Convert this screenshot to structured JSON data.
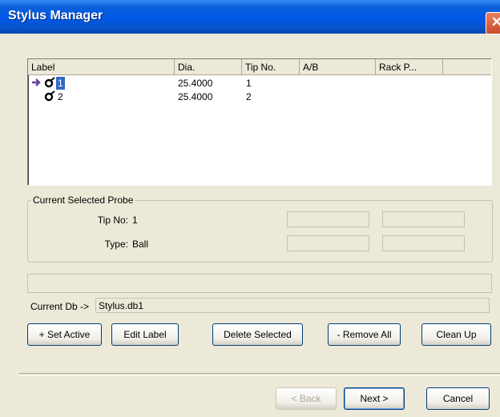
{
  "window": {
    "title": "Stylus Manager",
    "close_glyph": "✕"
  },
  "list": {
    "columns": [
      "Label",
      "Dia.",
      "Tip No.",
      "A/B",
      "Rack P..."
    ],
    "rows": [
      {
        "label": "1",
        "dia": "25.4000",
        "tip": "1",
        "active": true,
        "selected": true
      },
      {
        "label": "2",
        "dia": "25.4000",
        "tip": "2",
        "active": false,
        "selected": false
      }
    ],
    "icons": {
      "active": "active-arrow-icon",
      "probe": "probe-icon"
    }
  },
  "probe": {
    "group_label": "Current Selected Probe",
    "tip_label": "Tip No:",
    "tip_value": "1",
    "type_label": "Type:",
    "type_value": "Ball"
  },
  "db": {
    "label": "Current Db ->",
    "value": "Stylus.db1"
  },
  "buttons": {
    "set_active": "+ Set Active",
    "edit_label": "Edit Label",
    "delete_selected": "Delete Selected",
    "remove_all": "- Remove All",
    "clean_up": "Clean Up",
    "back": "< Back",
    "next": "Next >",
    "cancel": "Cancel"
  },
  "colors": {
    "title_bar": "#0058e6",
    "selection": "#316ac5",
    "active_arrow": "#6b3fa0"
  }
}
